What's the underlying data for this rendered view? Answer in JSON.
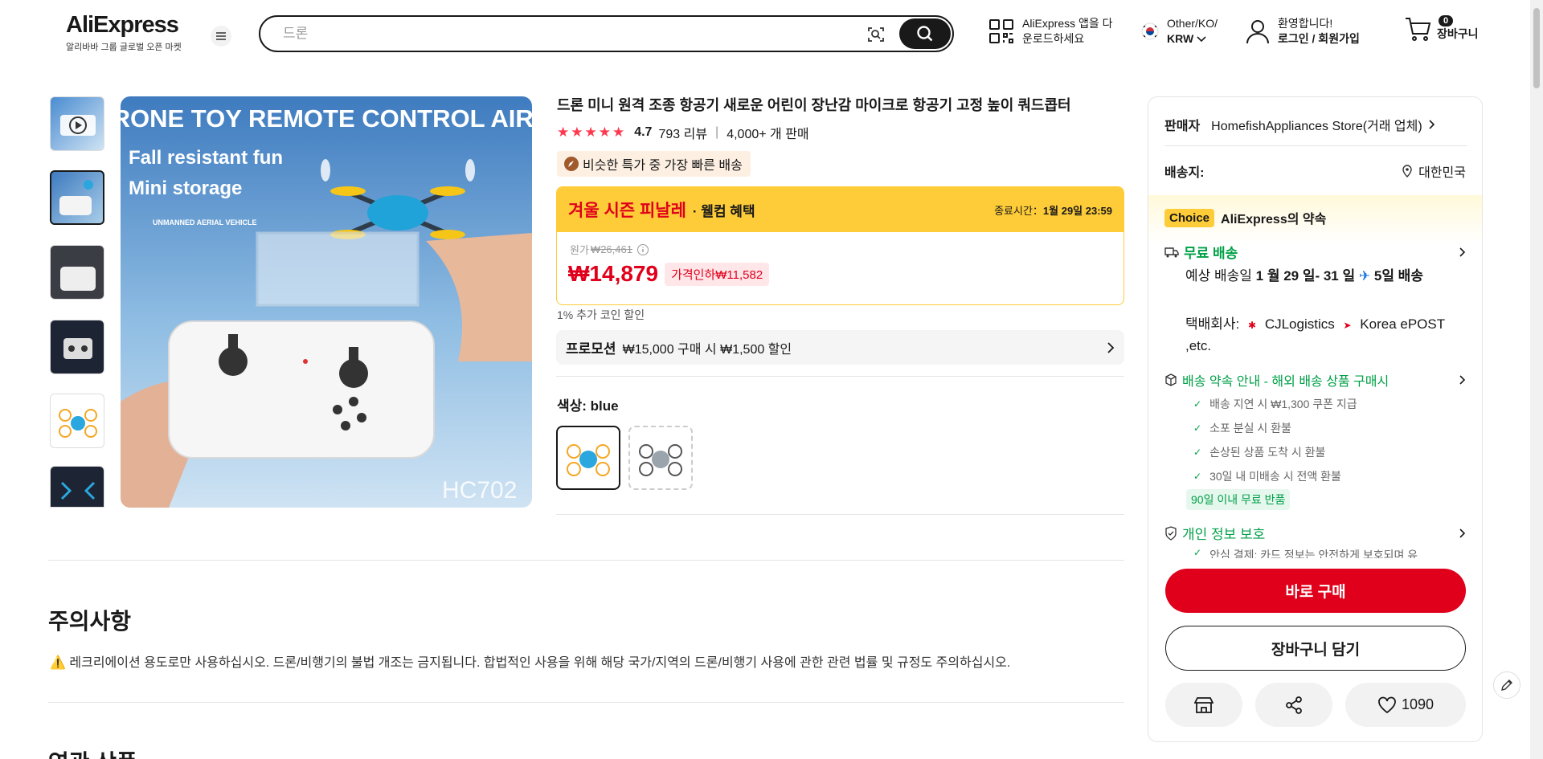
{
  "header": {
    "logo_text": "AliExpress",
    "logo_sub": "알리바바 그룹 글로벌 오픈 마켓",
    "search_placeholder": "드론",
    "app_line1": "AliExpress 앱을 다",
    "app_line2": "운로드하세요",
    "locale_line1": "Other/KO/",
    "locale_line2": "KRW",
    "welcome": "환영합니다!",
    "login": "로그인 / 회원가입",
    "cart_count": "0",
    "cart_label": "장바구니"
  },
  "gallery": {
    "image_headline": "MINI DRONE TOY REMOTE CONTROL AIRCRAFT",
    "image_tag1": "Fall resistant fun",
    "image_tag2": "Mini storage",
    "image_tag3": "UNMANNED AERIAL VEHICLE",
    "image_model": "HC702",
    "thumbnails": 6
  },
  "product": {
    "title": "드론 미니 원격 조종 항공기 새로운 어린이 장난감 마이크로 항공기 고정 높이 쿼드콥터",
    "stars": "★★★★★",
    "rating": "4.7",
    "reviews": "793 리뷰",
    "sold": "4,000+ 개 판매",
    "delivery_tag": "비슷한 특가 중 가장 빠른 배송",
    "sale_name": "겨울 시즌 피날레",
    "sale_sub": "· 웰컴 혜택",
    "sale_end_label": "종료시간：",
    "sale_end": "1월 29일 23:59",
    "orig_label": "원가",
    "orig_price": "₩26,461",
    "price": "₩14,879",
    "discount": "가격인하₩11,582",
    "coin_note": "1% 추가 코인 할인",
    "promo_label": "프로모션",
    "promo_text": "₩15,000 구매 시 ₩1,500 할인",
    "color_label": "색상: blue"
  },
  "notice": {
    "title": "주의사항",
    "text": "레크리에이션 용도로만 사용하십시오. 드론/비행기의 불법 개조는 금지됩니다. 합법적인 사용을 위해 해당 국가/지역의 드론/비행기 사용에 관한 관련 법률 및 규정도 주의하십시오.",
    "related_title": "연관 상품"
  },
  "panel": {
    "seller_label": "판매자",
    "seller_name": "HomefishAppliances Store(거래 업체)",
    "ship_to_label": "배송지:",
    "ship_to": "대한민국",
    "choice_tag": "Choice",
    "choice_text": "AliExpress의 약속",
    "free_ship": "무료 배송",
    "eta_prefix": "예상 배송일 ",
    "eta_dates": "1 월 29 일- 31 일",
    "eta_days": "5일 배송",
    "carrier_label": "택배회사:",
    "carrier1": "CJLogistics",
    "carrier2": "Korea",
    "carrier3": "ePOST ,etc.",
    "promise_title": "배송 약속 안내 - 해외 배송 상품 구매시",
    "promises": [
      "배송 지연 시 ₩1,300 쿠폰 지급",
      "소포 분실 시 환불",
      "손상된 상품 도착 시 환불",
      "30일 내 미배송 시 전액 환불"
    ],
    "return_tag": "90일 이내 무료 반품",
    "privacy_title": "개인 정보 보호",
    "privacy_text": "안심 결제: 카드 정보는 안전하게 보호되며 유",
    "buy_now": "바로 구매",
    "add_cart": "장바구니 담기",
    "wish_count": "1090"
  },
  "colors": {
    "accent_red": "#e0001b",
    "sale_yellow": "#fecc38",
    "green": "#00a047"
  }
}
